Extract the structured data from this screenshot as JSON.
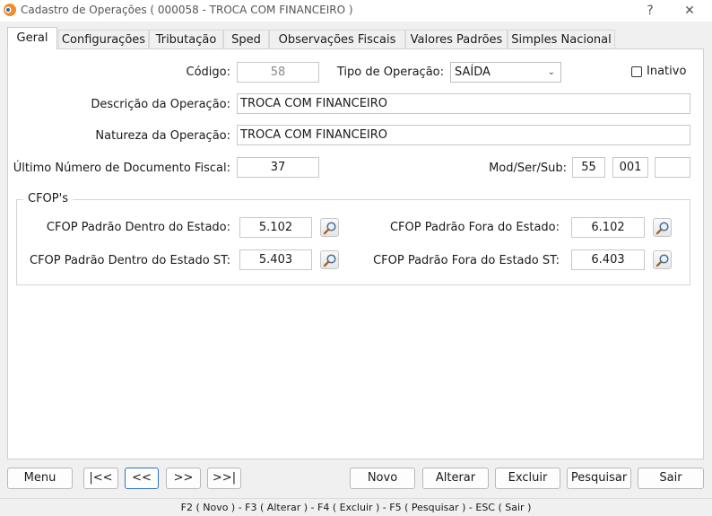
{
  "window": {
    "title": "Cadastro de Operações ( 000058 - TROCA COM FINANCEIRO )",
    "help": "?",
    "close": "✕"
  },
  "tabs": [
    "Geral",
    "Configurações",
    "Tributação",
    "Sped",
    "Observações Fiscais",
    "Valores Padrões",
    "Simples Nacional"
  ],
  "form": {
    "codigo_label": "Código:",
    "codigo_value": "58",
    "tipo_label": "Tipo de Operação:",
    "tipo_value": "SAÍDA",
    "inativo_label": "Inativo",
    "descricao_label": "Descrição da Operação:",
    "descricao_value": "TROCA COM FINANCEIRO",
    "natureza_label": "Natureza da Operação:",
    "natureza_value": "TROCA COM FINANCEIRO",
    "ultimo_label": "Último Número de Documento Fiscal:",
    "ultimo_value": "37",
    "modsersub_label": "Mod/Ser/Sub:",
    "mod_value": "55",
    "ser_value": "001",
    "sub_value": ""
  },
  "cfop": {
    "group_title": "CFOP's",
    "dentro_label": "CFOP Padrão Dentro do Estado:",
    "dentro_value": "5.102",
    "fora_label": "CFOP Padrão Fora do Estado:",
    "fora_value": "6.102",
    "dentro_st_label": "CFOP Padrão Dentro do Estado ST:",
    "dentro_st_value": "5.403",
    "fora_st_label": "CFOP Padrão Fora do Estado ST:",
    "fora_st_value": "6.403"
  },
  "buttons": {
    "menu": "Menu",
    "first": "|<<",
    "prev": "<<",
    "next": ">>",
    "last": ">>|",
    "novo": "Novo",
    "alterar": "Alterar",
    "excluir": "Excluir",
    "pesquisar": "Pesquisar",
    "sair": "Sair"
  },
  "status": "F2 ( Novo )  -  F3 ( Alterar )  -  F4 ( Excluir )  -  F5 ( Pesquisar )  -  ESC ( Sair )"
}
